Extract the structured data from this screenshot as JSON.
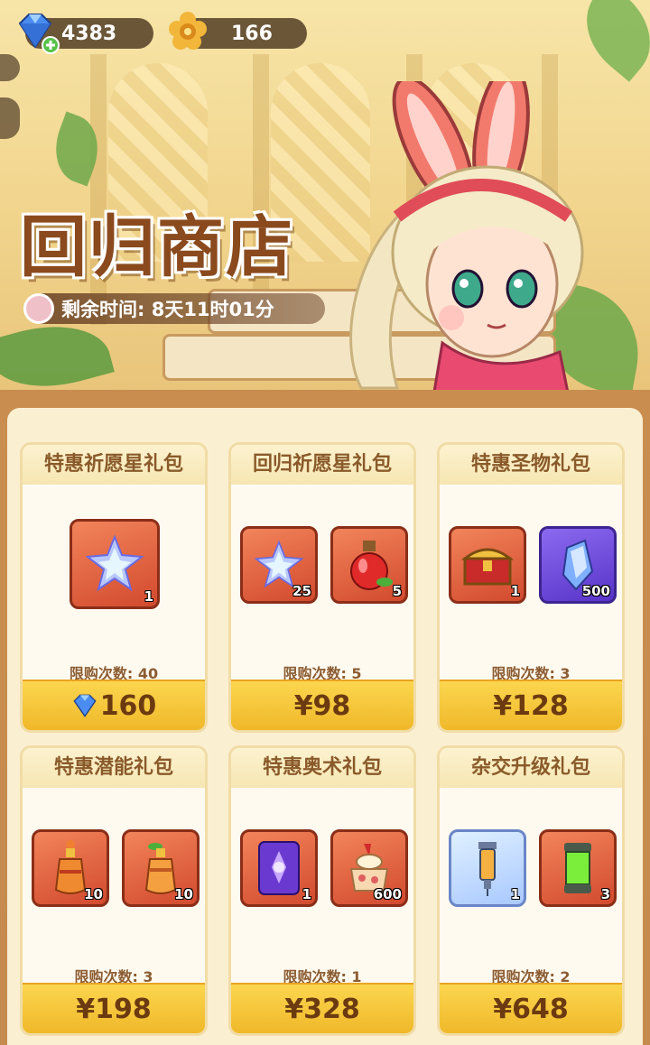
{
  "currencies": {
    "gems": "4383",
    "coins": "166"
  },
  "shop": {
    "title": "回归商店",
    "timer": "剩余时间: 8天11时01分"
  },
  "colors": {
    "accent": "#f0b82a",
    "panel": "#c98d4f",
    "title": "#8a4a1e"
  },
  "packs": [
    {
      "name": "特惠祈愿星礼包",
      "limit": "限购次数: 40",
      "price": "160",
      "price_icon": "gem-icon",
      "items": [
        {
          "icon": "wish-star-icon",
          "qty": "1"
        }
      ]
    },
    {
      "name": "回归祈愿星礼包",
      "limit": "限购次数: 5",
      "price": "¥98",
      "items": [
        {
          "icon": "wish-star-icon",
          "qty": "25"
        },
        {
          "icon": "red-potion-icon",
          "qty": "5"
        }
      ]
    },
    {
      "name": "特惠圣物礼包",
      "limit": "限购次数: 3",
      "price": "¥128",
      "items": [
        {
          "icon": "treasure-chest-icon",
          "qty": "1"
        },
        {
          "icon": "crystal-shard-icon",
          "qty": "500"
        }
      ]
    },
    {
      "name": "特惠潜能礼包",
      "limit": "限购次数: 3",
      "price": "¥198",
      "items": [
        {
          "icon": "potential-bottle-icon",
          "qty": "10"
        },
        {
          "icon": "orange-bottle-icon",
          "qty": "10"
        }
      ]
    },
    {
      "name": "特惠奥术礼包",
      "limit": "限购次数: 1",
      "price": "¥328",
      "items": [
        {
          "icon": "arcane-card-icon",
          "qty": "1"
        },
        {
          "icon": "sweet-dessert-icon",
          "qty": "600"
        }
      ]
    },
    {
      "name": "杂交升级礼包",
      "limit": "限购次数: 2",
      "price": "¥648",
      "items": [
        {
          "icon": "syringe-icon",
          "qty": "1"
        },
        {
          "icon": "green-capsule-icon",
          "qty": "3"
        }
      ]
    }
  ]
}
